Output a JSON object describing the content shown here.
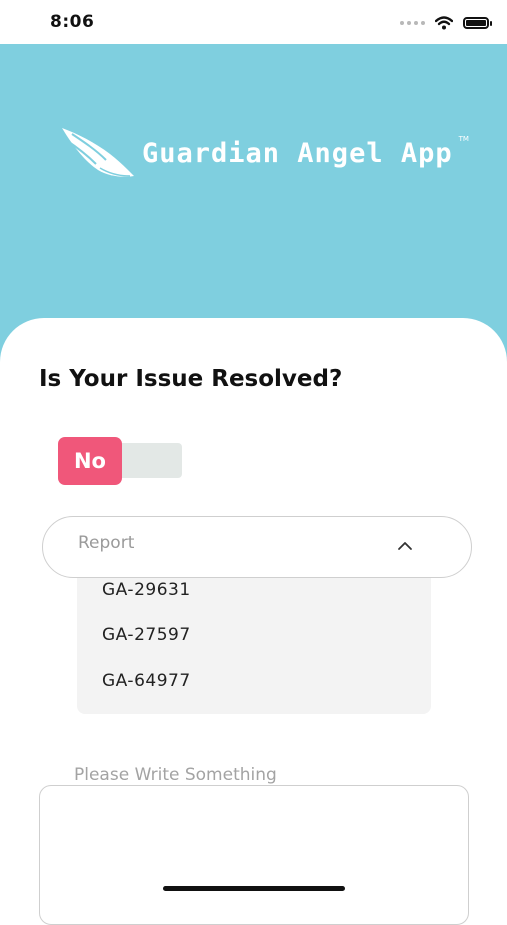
{
  "status_bar": {
    "time": "8:06"
  },
  "header": {
    "app_name": "Guardian Angel App",
    "trademark": "TM"
  },
  "form": {
    "question": "Is Your Issue Resolved?",
    "toggle_label": "No",
    "report_select": {
      "label": "Report",
      "options": [
        "GA-29631",
        "GA-27597",
        "GA-64977"
      ]
    },
    "message_placeholder": "Please Write Something"
  },
  "colors": {
    "hero_background": "#7fcfdf",
    "toggle_accent": "#f0577a"
  },
  "icons": [
    "wifi-icon",
    "battery-icon",
    "angel-wing-icon",
    "chevron-up-icon"
  ]
}
